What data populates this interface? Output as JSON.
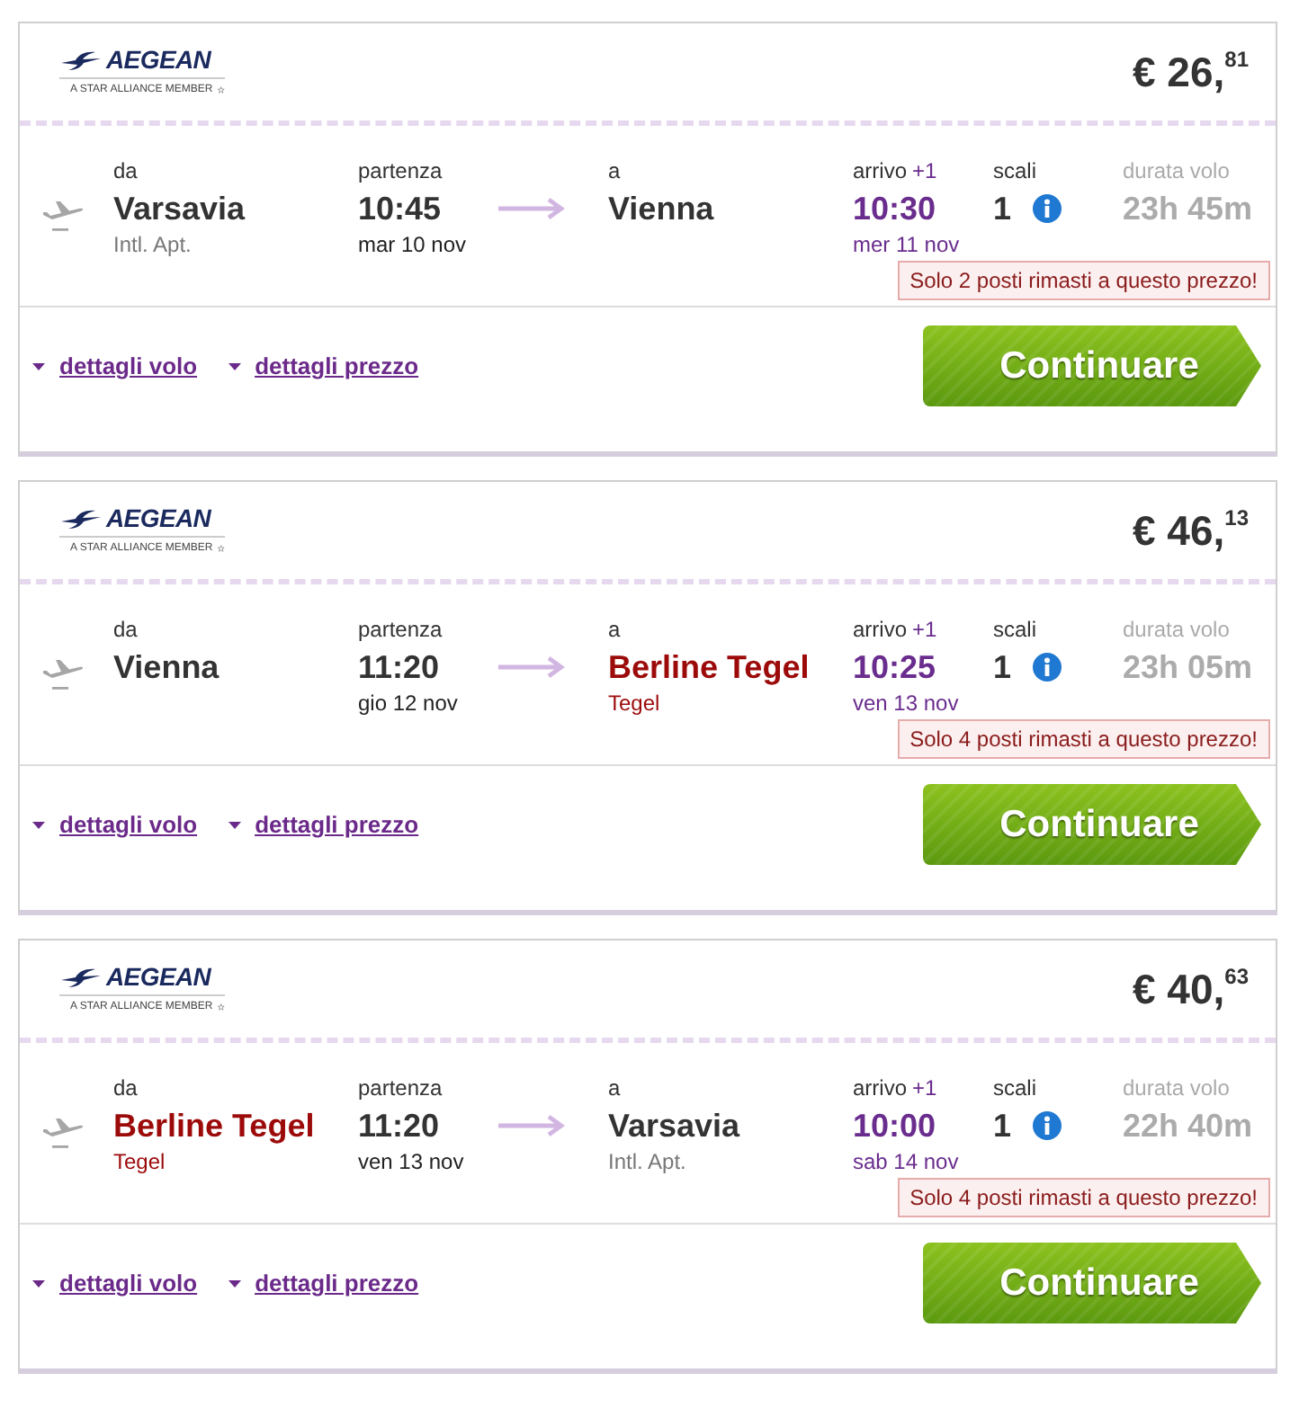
{
  "flights": [
    {
      "airline": {
        "name": "AEGEAN",
        "tagline": "A STAR ALLIANCE MEMBER"
      },
      "price": "€ 26,$^{81}$",
      "from": {
        "label": "da",
        "city": "Varsavia",
        "airport": "Intl. Apt.",
        "highlighted": false
      },
      "departure": {
        "label": "partenza",
        "time": "10:45",
        "date": "mar 10 nov"
      },
      "to": {
        "label": "a",
        "city": "Vienna",
        "highlighted": false
      },
      "arrival": {
        "label": "arrivo",
        "day_offset": "+1",
        "time": "10:30",
        "date": "mer 11 nov"
      },
      "stops": {
        "label": "scali",
        "count": "1"
      },
      "duration": {
        "label": "durata volo",
        "value": "23h 45m"
      },
      "availability": "Solo 2 posti rimasti a questo prezzo!",
      "links": [
        "dettagli volo",
        "dettagli prezzo"
      ],
      "button": "Continuare"
    },
    {
      "airline": {
        "name": "AEGEAN",
        "tagline": "A STAR ALLIANCE MEMBER"
      },
      "price": "€ 46,$^{13}$",
      "from": {
        "label": "da",
        "city": "Vienna",
        "highlighted": false
      },
      "departure": {
        "label": "partenza",
        "time": "11:20",
        "date": "gio 12 nov"
      },
      "to": {
        "label": "a",
        "city": "Berline Tegel",
        "airport": "Tegel",
        "highlighted": true
      },
      "arrival": {
        "label": "arrivo",
        "day_offset": "+1",
        "time": "10:25",
        "date": "ven 13 nov"
      },
      "stops": {
        "label": "scali",
        "count": "1"
      },
      "duration": {
        "label": "durata volo",
        "value": "23h 05m"
      },
      "availability": "Solo 4 posti rimasti a questo prezzo!",
      "links": [
        "dettagli volo",
        "dettagli prezzo"
      ],
      "button": "Continuare"
    },
    {
      "airline": {
        "name": "AEGEAN",
        "tagline": "A STAR ALLIANCE MEMBER"
      },
      "price": "€ 40,$^{63}$",
      "from": {
        "label": "da",
        "city": "Berline Tegel",
        "airport": "Tegel",
        "highlighted": true
      },
      "departure": {
        "label": "partenza",
        "time": "11:20",
        "date": "ven 13 nov"
      },
      "to": {
        "label": "a",
        "city": "Varsavia",
        "airport": "Intl. Apt.",
        "highlighted": false
      },
      "arrival": {
        "label": "arrivo",
        "day_offset": "+1",
        "time": "10:00",
        "date": "sab 14 nov"
      },
      "stops": {
        "label": "scali",
        "count": "1"
      },
      "duration": {
        "label": "durata volo",
        "value": "22h 40m"
      },
      "availability": "Solo 4 posti rimasti a questo prezzo!",
      "links": [
        "dettagli volo",
        "dettagli prezzo"
      ],
      "button": "Continuare"
    }
  ]
}
